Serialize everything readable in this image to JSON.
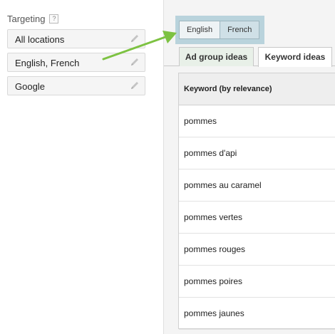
{
  "targeting": {
    "title": "Targeting",
    "help": "?",
    "items": [
      {
        "label": "All locations"
      },
      {
        "label": "English, French"
      },
      {
        "label": "Google"
      }
    ]
  },
  "languages": {
    "options": [
      "English",
      "French"
    ],
    "selected": "French"
  },
  "tabs": [
    {
      "label": "Ad group ideas"
    },
    {
      "label": "Keyword ideas"
    }
  ],
  "active_tab": "Keyword ideas",
  "table": {
    "header": "Keyword (by relevance)",
    "rows": [
      "pommes",
      "pommes d'api",
      "pommes au caramel",
      "pommes vertes",
      "pommes rouges",
      "pommes poires",
      "pommes jaunes"
    ]
  },
  "colors": {
    "arrow": "#7dc242",
    "highlight": "#b9d3dc",
    "tab_inactive": "#e8f0e8"
  },
  "icons": {
    "edit": "pencil-icon",
    "help": "help-icon"
  }
}
